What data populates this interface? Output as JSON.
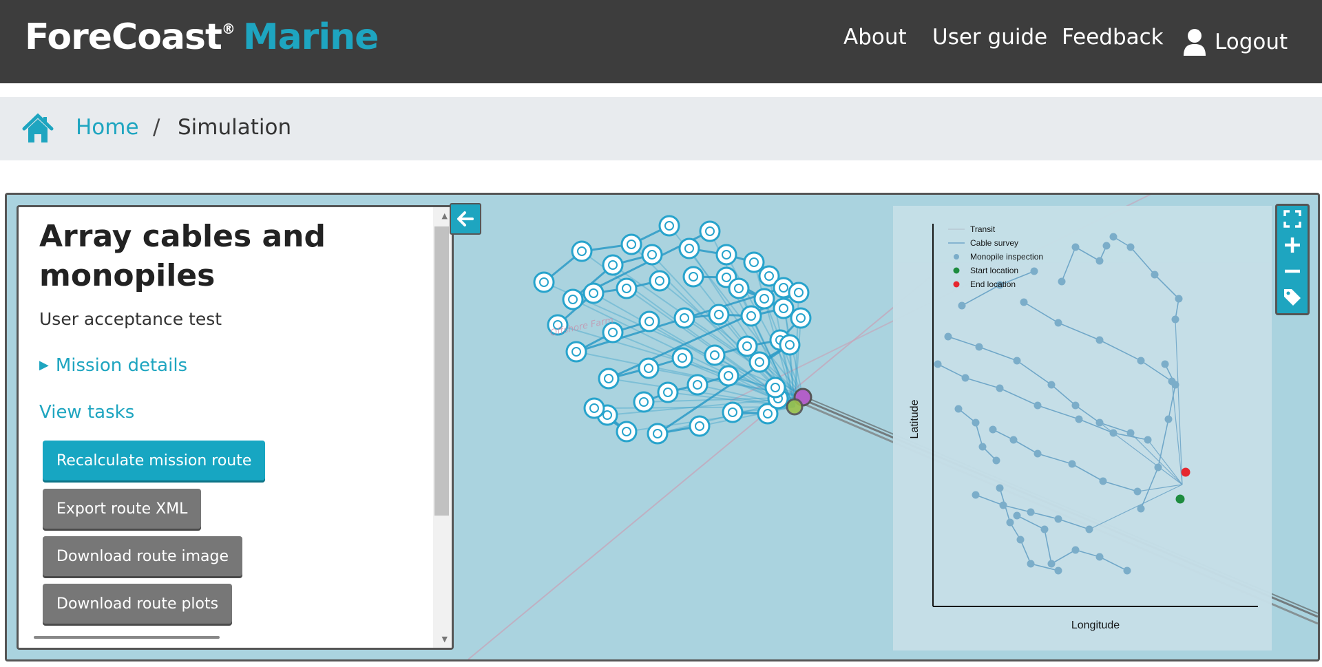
{
  "header": {
    "brand_primary": "ForeCoast",
    "brand_reg": "®",
    "brand_secondary": "Marine",
    "nav": {
      "about": "About",
      "user_guide": "User guide",
      "feedback": "Feedback",
      "logout": "Logout"
    }
  },
  "breadcrumb": {
    "home": "Home",
    "separator": "/",
    "current": "Simulation"
  },
  "panel": {
    "title": "Array cables and monopiles",
    "subtitle": "User acceptance test",
    "mission_details": "Mission details",
    "view_tasks": "View tasks",
    "buttons": {
      "recalculate": "Recalculate mission route",
      "export_xml": "Export route XML",
      "download_image": "Download route image",
      "download_plots": "Download route plots"
    }
  },
  "map": {
    "watermark_text": "Offshore Farm",
    "controls": [
      "fullscreen-icon",
      "zoom-in-icon",
      "zoom-out-icon",
      "tag-icon"
    ]
  },
  "route_plot": {
    "xlabel": "Longitude",
    "ylabel": "Latitude",
    "legend": {
      "transit": "Transit",
      "cable_survey": "Cable survey",
      "monopile_inspection": "Monopile inspection",
      "start_location": "Start location",
      "end_location": "End location"
    }
  },
  "colors": {
    "accent": "#1ea5c0",
    "header_bg": "#3d3d3d",
    "map_water": "#aad3df",
    "button_grey": "#777777",
    "start": "#1a8a3a",
    "end": "#e8222a"
  }
}
